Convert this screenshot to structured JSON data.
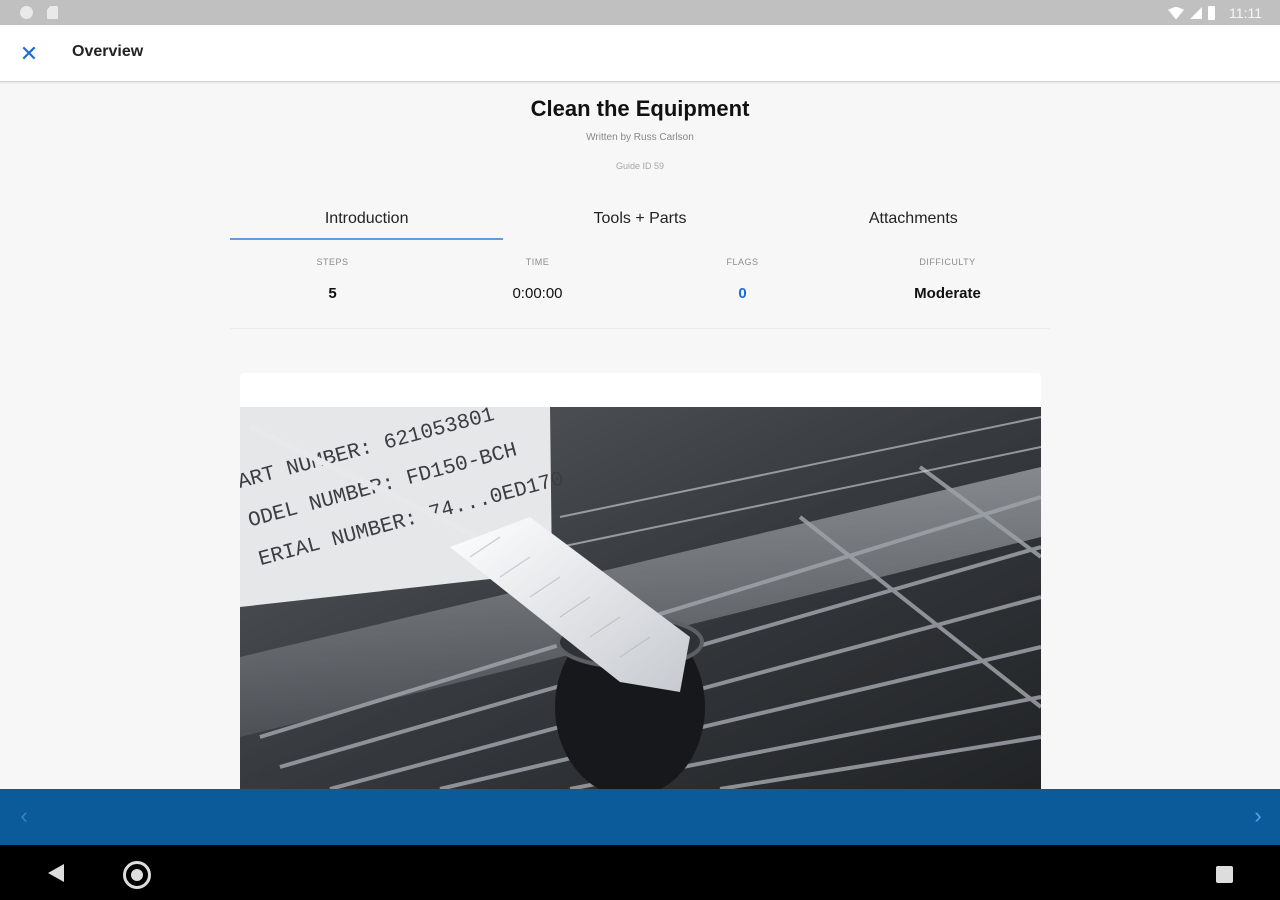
{
  "status_bar": {
    "time": "11:11",
    "icons": [
      "notification-dot-icon",
      "sd-card-icon",
      "wifi-icon",
      "signal-icon",
      "battery-icon"
    ]
  },
  "app_bar": {
    "close_icon": "close-icon",
    "title": "Overview"
  },
  "guide": {
    "title": "Clean the Equipment",
    "author": "Written by Russ Carlson",
    "guide_id": "Guide ID 59"
  },
  "tabs": [
    {
      "label": "Introduction",
      "active": true
    },
    {
      "label": "Tools + Parts",
      "active": false
    },
    {
      "label": "Attachments",
      "active": false
    }
  ],
  "stats": {
    "steps_label": "STEPS",
    "steps_value": "5",
    "time_label": "TIME",
    "time_value": "0:00:00",
    "flags_label": "FLAGS",
    "flags_value": "0",
    "difficulty_label": "DIFFICULTY",
    "difficulty_value": "Moderate"
  },
  "photo": {
    "label_lines": [
      "ART NUMBER: 621053801",
      "ODEL NUMBER: FD150-BCH",
      "ERIAL NUMBER: 74...0ED170"
    ]
  },
  "bottom_nav": {
    "prev_icon": "chevron-left-icon",
    "next_icon": "chevron-right-icon"
  },
  "colors": {
    "accent": "#1e6bd6",
    "bottom_bar": "#0b5a99",
    "tab_indicator": "#5f9ddb"
  }
}
